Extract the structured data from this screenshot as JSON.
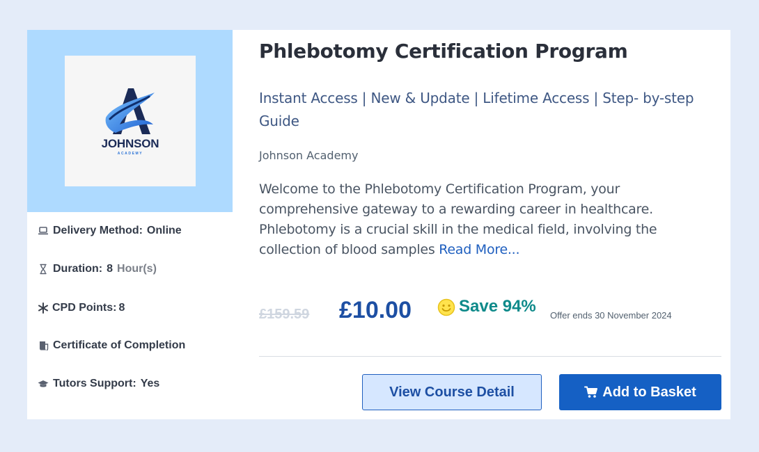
{
  "course": {
    "title": "Phlebotomy Certification Program",
    "subtitle": "Instant Access | New & Update | Lifetime Access | Step- by-step Guide",
    "provider": "Johnson Academy",
    "description": "Welcome to the Phlebotomy Certification Program, your comprehensive gateway to a rewarding career in healthcare. Phlebotomy is a crucial skill in the medical field, involving the collection of blood samples",
    "read_more": "Read More..."
  },
  "logo": {
    "name": "JOHNSON",
    "subname": "ACADEMY",
    "colors": {
      "navy": "#1b2b57",
      "blue": "#2b73d6",
      "light_blue": "#5aa9f0"
    }
  },
  "meta": {
    "delivery": {
      "label": "Delivery Method:",
      "value": "Online",
      "icon": "laptop-icon"
    },
    "duration": {
      "label": "Duration:",
      "value": "8",
      "unit": "Hour(s)",
      "icon": "hourglass-icon"
    },
    "cpd": {
      "label": "CPD Points:",
      "value": "8",
      "icon": "asterisk-icon"
    },
    "certificate": {
      "label": "Certificate of Completion",
      "icon": "certificate-icon"
    },
    "tutors": {
      "label": "Tutors Support:",
      "value": "Yes",
      "icon": "graduation-cap-icon"
    }
  },
  "pricing": {
    "old_price": "£159.59",
    "price": "£10.00",
    "save": "Save 94%",
    "offer": "Offer ends 30 November 2024",
    "save_icon": "smiley-icon"
  },
  "actions": {
    "detail_label": "View Course Detail",
    "basket_label": "Add to Basket",
    "basket_icon": "cart-icon"
  },
  "colors": {
    "page_bg": "#e4ecf9",
    "logo_panel": "#aedaff",
    "price": "#1d4fa3",
    "save": "#0e8a8a",
    "button_primary": "#1560c4",
    "button_secondary": "#d6e7ff"
  }
}
